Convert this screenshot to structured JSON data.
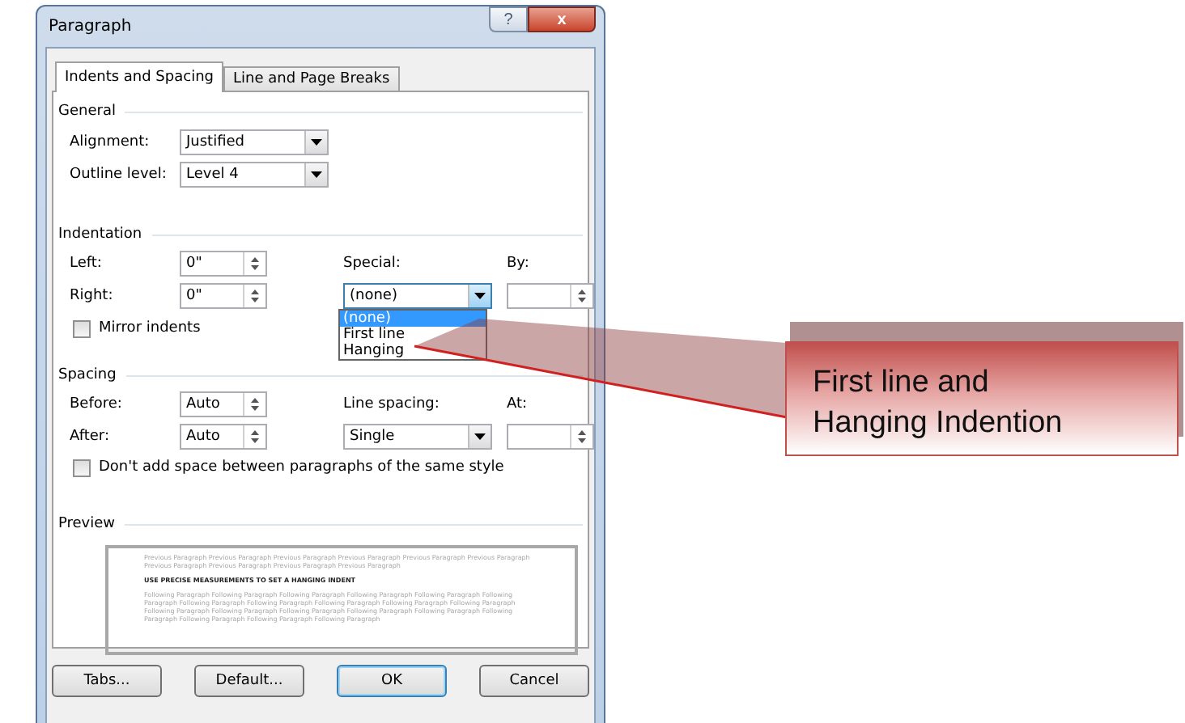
{
  "window": {
    "title": "Paragraph",
    "help": "?",
    "close": "x"
  },
  "tabs": [
    {
      "label": "Indents and Spacing",
      "selected": true
    },
    {
      "label": "Line and Page Breaks",
      "selected": false
    }
  ],
  "general": {
    "heading": "General",
    "fields": [
      {
        "label": "Alignment:",
        "value": "Justified"
      },
      {
        "label": "Outline level:",
        "value": "Level 4"
      }
    ]
  },
  "indentation": {
    "heading": "Indentation",
    "left": {
      "label": "Left:",
      "value": "0\""
    },
    "right": {
      "label": "Right:",
      "value": "0\""
    },
    "special": {
      "label": "Special:",
      "value": "(none)",
      "expanded": true,
      "options": [
        {
          "label": "(none)",
          "selected": true
        },
        {
          "label": "First line",
          "selected": false
        },
        {
          "label": "Hanging",
          "selected": false
        }
      ]
    },
    "by": {
      "label": "By:"
    },
    "mirror": {
      "label": "Mirror indents",
      "checked": false
    }
  },
  "spacing": {
    "heading": "Spacing",
    "before": {
      "label": "Before:",
      "value": "Auto"
    },
    "after": {
      "label": "After:",
      "value": "Auto"
    },
    "line_spacing": {
      "label": "Line spacing:",
      "value": "Single"
    },
    "at": {
      "label": "At:"
    },
    "no_space": {
      "label": "Don't add space between paragraphs of the same style",
      "checked": false
    }
  },
  "preview": {
    "heading": "Preview",
    "previous": "Previous Paragraph Previous Paragraph Previous Paragraph Previous Paragraph Previous Paragraph Previous Paragraph Previous Paragraph Previous Paragraph Previous Paragraph Previous Paragraph",
    "sample": "USE PRECISE MEASUREMENTS TO SET A HANGING INDENT",
    "following": "Following Paragraph Following Paragraph Following Paragraph Following Paragraph Following Paragraph Following Paragraph Following Paragraph Following Paragraph Following Paragraph Following Paragraph Following Paragraph Following Paragraph Following Paragraph Following Paragraph Following Paragraph Following Paragraph Following Paragraph Following Paragraph Following Paragraph Following Paragraph"
  },
  "buttons": [
    {
      "label": "Tabs...",
      "default": false
    },
    {
      "label": "Default...",
      "default": false
    },
    {
      "label": "OK",
      "default": true
    },
    {
      "label": "Cancel",
      "default": false
    }
  ],
  "callout": {
    "lines": [
      "First line and",
      "Hanging Indention"
    ]
  }
}
